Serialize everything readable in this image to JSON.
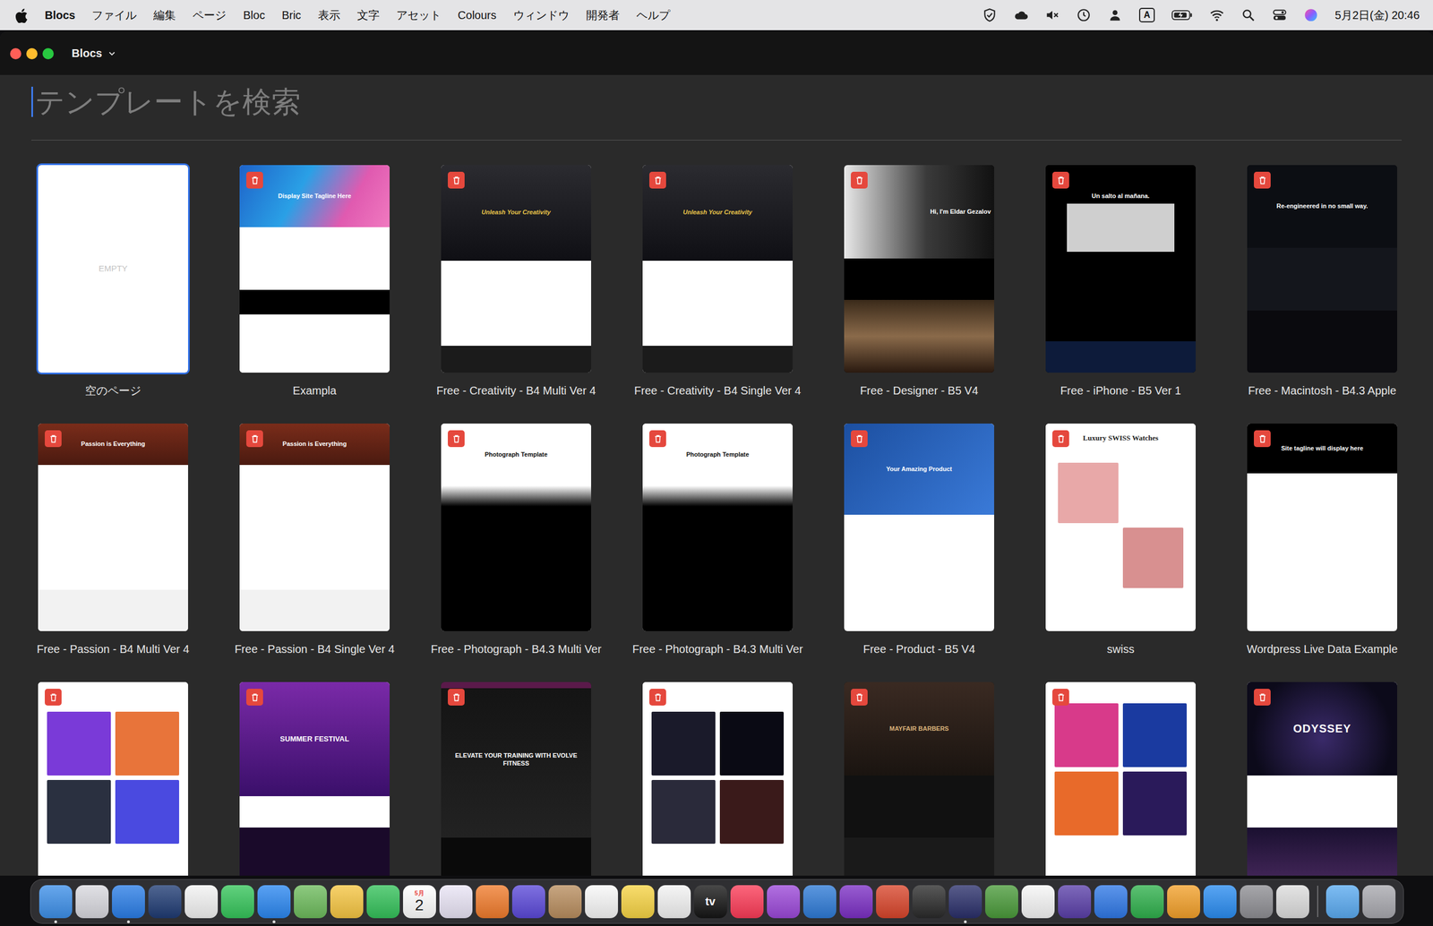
{
  "menubar": {
    "app": "Blocs",
    "items": [
      "ファイル",
      "編集",
      "ページ",
      "Bloc",
      "Bric",
      "表示",
      "文字",
      "アセット",
      "Colours",
      "ウィンドウ",
      "開発者",
      "ヘルプ"
    ],
    "input_source": "A",
    "clock": "5月2日(金) 20:46"
  },
  "window": {
    "title": "Blocs"
  },
  "search": {
    "placeholder": "テンプレートを検索"
  },
  "templates": [
    {
      "label": "空のページ",
      "kind": "empty",
      "headline": "EMPTY",
      "selected": true,
      "deletable": false
    },
    {
      "label": "Exampla",
      "kind": "blog",
      "headline": "Display Site Tagline Here",
      "selected": false,
      "deletable": true
    },
    {
      "label": "Free - Creativity - B4 Multi Ver 4",
      "kind": "city",
      "headline": "Unleash Your Creativity",
      "selected": false,
      "deletable": true
    },
    {
      "label": "Free - Creativity - B4 Single Ver 4",
      "kind": "city",
      "headline": "Unleash Your Creativity",
      "selected": false,
      "deletable": true
    },
    {
      "label": "Free - Designer - B5 V4",
      "kind": "portrait",
      "headline": "Hi, I'm Eldar Gezalov",
      "selected": false,
      "deletable": true
    },
    {
      "label": "Free - iPhone - B5 Ver 1",
      "kind": "phone",
      "headline": "Un salto al mañana.",
      "selected": false,
      "deletable": true
    },
    {
      "label": "Free - Macintosh - B4.3 Apple",
      "kind": "mac",
      "headline": "Re-engineered in no small way.",
      "selected": false,
      "deletable": true
    },
    {
      "label": "Free - Passion - B4 Multi Ver 4",
      "kind": "passion",
      "headline": "Passion is Everything",
      "selected": false,
      "deletable": true
    },
    {
      "label": "Free - Passion - B4 Single Ver 4",
      "kind": "passion",
      "headline": "Passion is Everything",
      "selected": false,
      "deletable": true
    },
    {
      "label": "Free - Photograph - B4.3 Multi Ver",
      "kind": "photo",
      "headline": "Photograph Template",
      "selected": false,
      "deletable": true
    },
    {
      "label": "Free - Photograph - B4.3 Multi Ver",
      "kind": "photo",
      "headline": "Photograph Template",
      "selected": false,
      "deletable": true
    },
    {
      "label": "Free - Product - B5 V4",
      "kind": "product",
      "headline": "Your Amazing Product",
      "selected": false,
      "deletable": true
    },
    {
      "label": "swiss",
      "kind": "swiss",
      "headline": "Luxury SWISS Watches",
      "selected": false,
      "deletable": true
    },
    {
      "label": "Wordpress Live Data Example",
      "kind": "tagline",
      "headline": "Site tagline will display here",
      "selected": false,
      "deletable": true
    },
    {
      "kind": "gallery",
      "selected": false,
      "deletable": true
    },
    {
      "kind": "festival",
      "headline": "SUMMER FESTIVAL",
      "selected": false,
      "deletable": true
    },
    {
      "kind": "fitness",
      "headline": "ELEVATE YOUR TRAINING WITH EVOLVE FITNESS",
      "selected": false,
      "deletable": true
    },
    {
      "kind": "store",
      "selected": false,
      "deletable": true
    },
    {
      "kind": "barbers",
      "headline": "MAYFAIR BARBERS",
      "selected": false,
      "deletable": true
    },
    {
      "kind": "art",
      "selected": false,
      "deletable": true
    },
    {
      "kind": "odyssey",
      "headline": "ODYSSEY",
      "selected": false,
      "deletable": true
    }
  ],
  "dock": {
    "items": [
      {
        "kind": "app",
        "color": "#3d8fe8",
        "running": true
      },
      {
        "kind": "app",
        "color": "#d8d8de",
        "running": false
      },
      {
        "kind": "app",
        "color": "#2a7de6",
        "running": true
      },
      {
        "kind": "app",
        "color": "#1f3b73",
        "running": false
      },
      {
        "kind": "app",
        "color": "#f2f2f2",
        "running": false
      },
      {
        "kind": "app",
        "color": "#35c45a",
        "running": false
      },
      {
        "kind": "app",
        "color": "#2b87f0",
        "running": true
      },
      {
        "kind": "app",
        "color": "#6dbb5c",
        "running": false
      },
      {
        "kind": "app",
        "color": "#f5c542",
        "running": false
      },
      {
        "kind": "app",
        "color": "#34c15a",
        "running": false
      },
      {
        "kind": "calendar",
        "color": "#ffffff",
        "running": false,
        "month": "5月",
        "day": "2"
      },
      {
        "kind": "app",
        "color": "#e9e4f5",
        "running": false
      },
      {
        "kind": "app",
        "color": "#f07b2c",
        "running": false
      },
      {
        "kind": "app",
        "color": "#5b49d8",
        "running": false
      },
      {
        "kind": "app",
        "color": "#b88d5e",
        "running": false
      },
      {
        "kind": "app",
        "color": "#f7f7f7",
        "running": false
      },
      {
        "kind": "app",
        "color": "#f6d344",
        "running": false
      },
      {
        "kind": "app",
        "color": "#f2f2f2",
        "running": false
      },
      {
        "kind": "tv",
        "color": "#151515",
        "running": false,
        "text": "tv"
      },
      {
        "kind": "app",
        "color": "#fb3b57",
        "running": false
      },
      {
        "kind": "app",
        "color": "#9b48d8",
        "running": false
      },
      {
        "kind": "app",
        "color": "#2e7ad6",
        "running": false
      },
      {
        "kind": "app",
        "color": "#7b2fc4",
        "running": false
      },
      {
        "kind": "app",
        "color": "#d8452b",
        "running": false
      },
      {
        "kind": "app",
        "color": "#2a2a2a",
        "running": false
      },
      {
        "kind": "app",
        "color": "#2a2f6a",
        "running": true
      },
      {
        "kind": "app",
        "color": "#4a9a3a",
        "running": false
      },
      {
        "kind": "app",
        "color": "#f5f5f5",
        "running": false
      },
      {
        "kind": "app",
        "color": "#5a3fa8",
        "running": false
      },
      {
        "kind": "app",
        "color": "#2f78e6",
        "running": false
      },
      {
        "kind": "app",
        "color": "#2fb04c",
        "running": false
      },
      {
        "kind": "app",
        "color": "#f2a02a",
        "running": false
      },
      {
        "kind": "app",
        "color": "#2a8cf0",
        "running": false
      },
      {
        "kind": "app",
        "color": "#8e8e93",
        "running": false
      },
      {
        "kind": "app",
        "color": "#dcdcdc",
        "running": false
      },
      {
        "kind": "separator"
      },
      {
        "kind": "app",
        "color": "#5aaaf0",
        "running": false
      },
      {
        "kind": "app",
        "color": "#a8a8ae",
        "running": false
      }
    ]
  }
}
